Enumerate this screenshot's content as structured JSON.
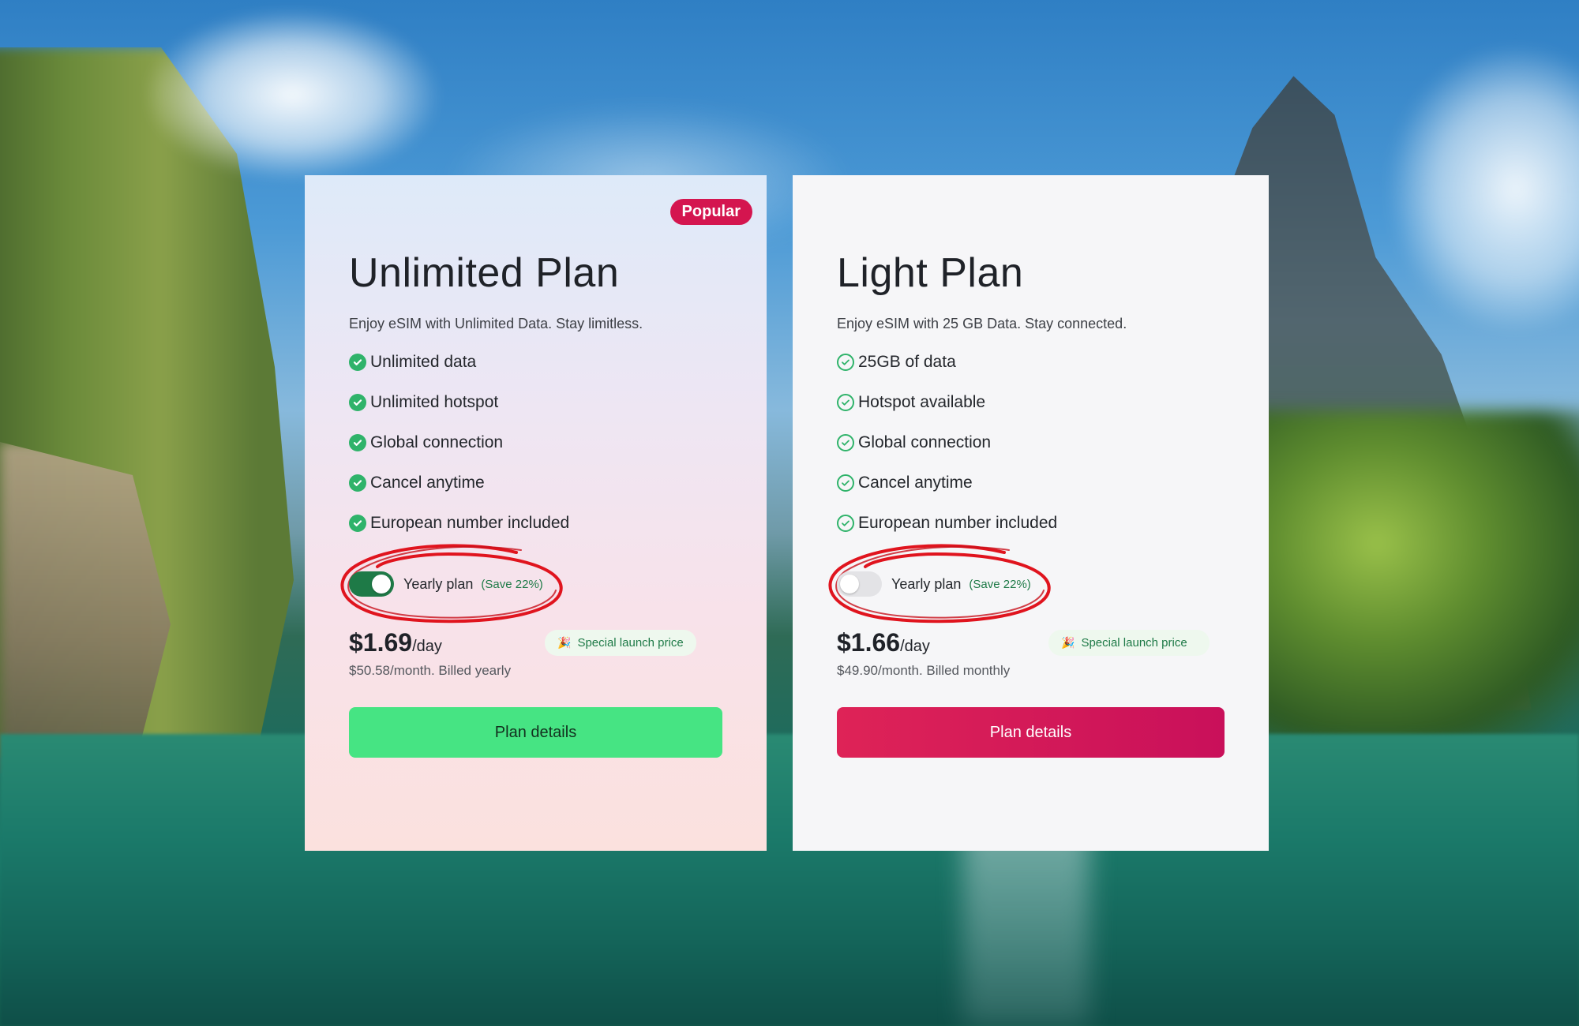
{
  "colors": {
    "brand_red": "#d4154f",
    "accent_green": "#46e483",
    "toggle_on": "#1e7a47",
    "check_green": "#2fb36a",
    "annotation_red": "#e0141e"
  },
  "plans": [
    {
      "badge": "Popular",
      "title": "Unlimited Plan",
      "subtitle": "Enjoy eSIM with Unlimited Data. Stay limitless.",
      "check_style": "check-circle-filled-icon",
      "features": [
        "Unlimited data",
        "Unlimited hotspot",
        "Global connection",
        "Cancel anytime",
        "European number included"
      ],
      "yearly_toggle": {
        "label": "Yearly plan",
        "save": "(Save 22%)",
        "on": true
      },
      "price": {
        "amount": "$1.69",
        "unit": "/day",
        "note": "$50.58/month. Billed yearly"
      },
      "special": {
        "icon": "party-popper-icon",
        "text": "Special launch price"
      },
      "cta": "Plan details"
    },
    {
      "title": "Light Plan",
      "subtitle": "Enjoy eSIM with 25 GB Data. Stay connected.",
      "check_style": "check-circle-outline-icon",
      "features": [
        "25GB of data",
        "Hotspot available",
        "Global connection",
        "Cancel anytime",
        "European number included"
      ],
      "yearly_toggle": {
        "label": "Yearly plan",
        "save": "(Save 22%)",
        "on": false
      },
      "price": {
        "amount": "$1.66",
        "unit": "/day",
        "note": "$49.90/month. Billed monthly"
      },
      "special": {
        "icon": "party-popper-icon",
        "text": "Special launch price"
      },
      "cta": "Plan details"
    }
  ]
}
